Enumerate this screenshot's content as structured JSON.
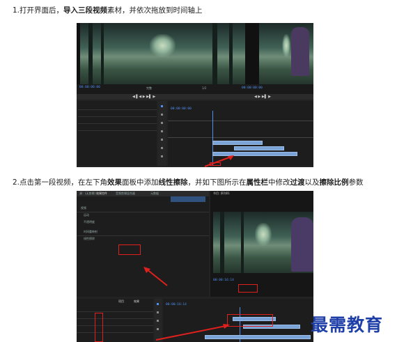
{
  "steps": [
    {
      "pre": "1.打开界面后，",
      "bold1": "导入三段视频",
      "mid": "素材，并依次拖放到时间轴上",
      "bold2": "",
      "mid2": "",
      "bold3": "",
      "mid3": "",
      "bold4": "",
      "mid4": "",
      "bold5": "",
      "post": ""
    },
    {
      "pre": "2.点击第一段视频，在左下角",
      "bold1": "效果",
      "mid": "面板中添加",
      "bold2": "线性擦除",
      "mid2": "，并如下图所示在",
      "bold3": "属性栏",
      "mid3": "中修改",
      "bold4": "过渡",
      "mid4": "以及",
      "bold5": "擦除比例",
      "post": "参数"
    }
  ],
  "shot1": {
    "program_timecode": "00:00:00:00",
    "timeline_timecode": "00:00:00:00",
    "program_fit": "完整",
    "fraction": "1/2"
  },
  "shot2": {
    "tabs": [
      "源：(无剪辑)",
      "效果控件",
      "音频剪辑混合器",
      "元数据"
    ],
    "effect_items": [
      "视频",
      "运动",
      "不透明度",
      "时间重映射",
      "线性擦除"
    ],
    "program_title": "节目: 序列01",
    "program_timecode": "00:00:16:14",
    "timeline_timecode": "00:00:16:14",
    "bottom_tabs": [
      "项目",
      "效果"
    ]
  },
  "watermark": "最需教育"
}
